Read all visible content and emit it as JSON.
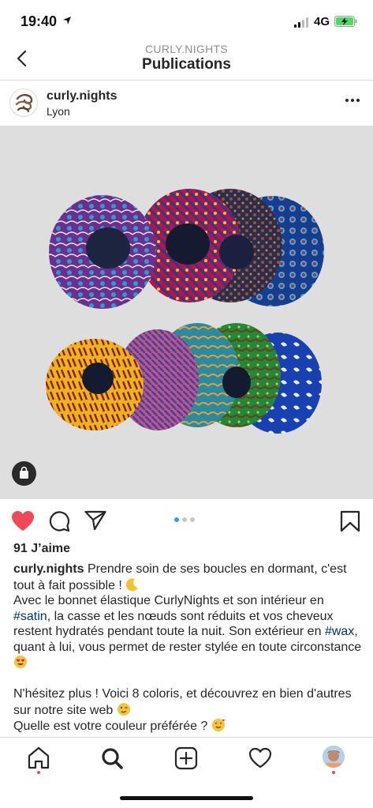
{
  "status_bar": {
    "time": "19:40",
    "network": "4G",
    "icons": [
      "location-arrow-icon",
      "signal-icon",
      "battery-charging-icon"
    ]
  },
  "header": {
    "account": "CURLY.NIGHTS",
    "title": "Publications",
    "back_icon": "chevron-left-icon"
  },
  "post": {
    "username": "curly.nights",
    "location": "Lyon",
    "more_icon": "ellipsis-icon",
    "image_alt_icon": "shopping-bag-icon",
    "carousel": {
      "count": 3,
      "active_index": 0
    },
    "liked": true,
    "likes_text": "91 J’aime",
    "caption": {
      "username": "curly.nights",
      "line1": "Prendre soin de ses boucles en dormant, c'est tout à fait possible !",
      "part2a": "Avec le bonnet élastique CurlyNights et son intérieur en",
      "tag_satin": "#satin",
      "part2b": ", la casse et les nœuds sont réduits et vos cheveux restent hydratés pendant toute la nuit. Son extérieur en",
      "tag_wax": "#wax",
      "part2c": ", quant à lui, vous permet de rester stylée en toute circonstance",
      "line3": "N'hésitez plus ! Voici 8 coloris, et découvrez en bien d'autres sur notre site web",
      "line4": "Quelle est votre couleur préférée ?"
    }
  },
  "tabbar": {
    "items": [
      "home-icon",
      "search-icon",
      "new-post-icon",
      "activity-heart-icon",
      "profile-avatar"
    ]
  },
  "colors": {
    "like_red": "#ed4956",
    "link_blue": "#003569",
    "carousel_active": "#3897f0"
  }
}
